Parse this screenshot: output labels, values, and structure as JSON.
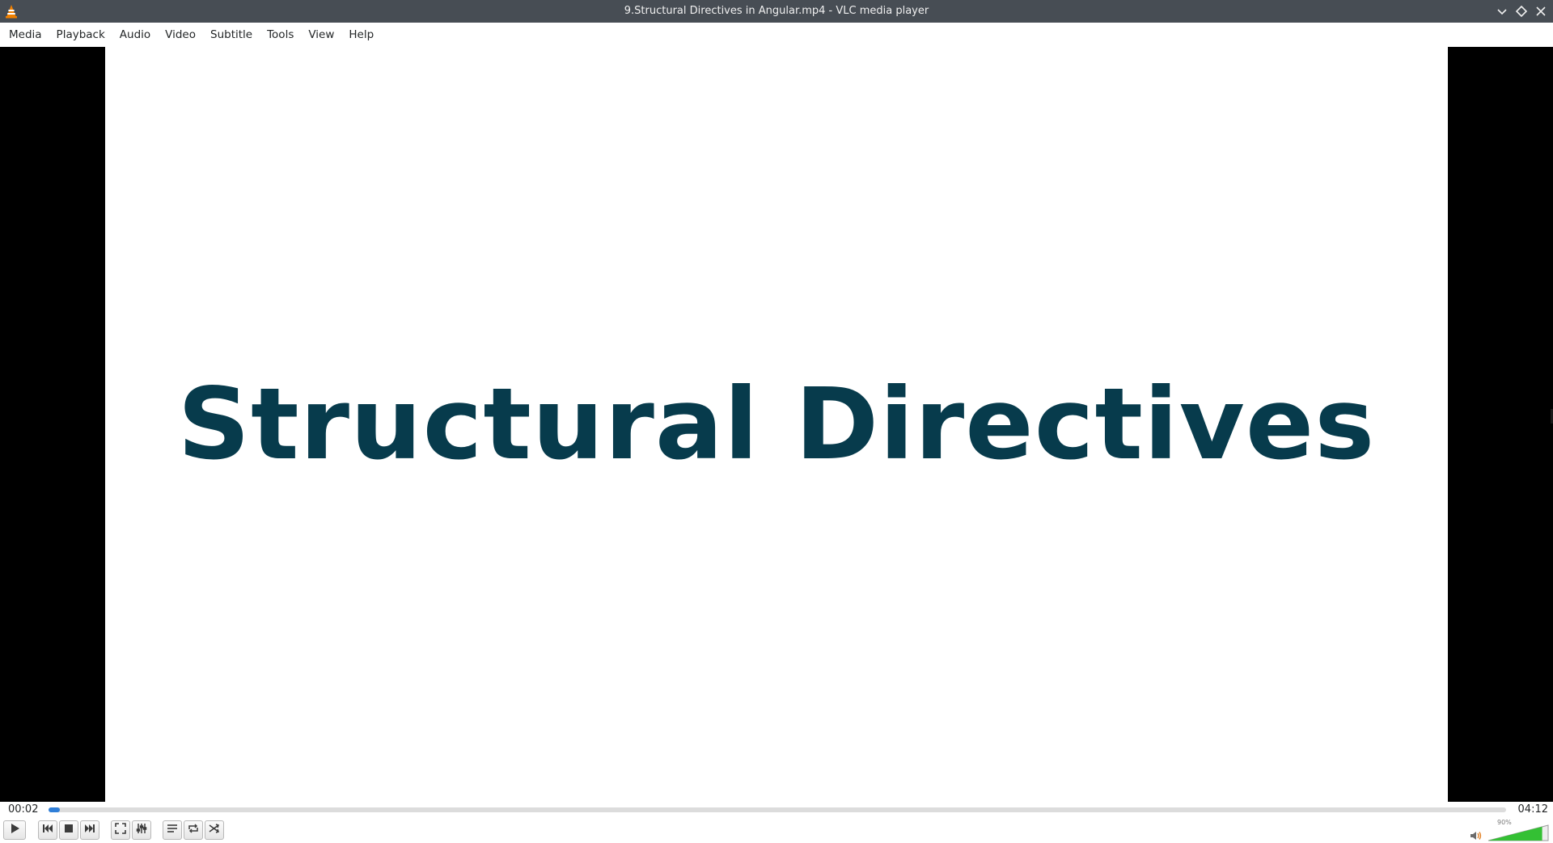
{
  "window": {
    "title": "9.Structural Directives in Angular.mp4 - VLC media player"
  },
  "menu": [
    "Media",
    "Playback",
    "Audio",
    "Video",
    "Subtitle",
    "Tools",
    "View",
    "Help"
  ],
  "video": {
    "frame_text": "Structural Directives",
    "frame_text_color": "#073b4c",
    "background": "#ffffff"
  },
  "playback": {
    "elapsed": "00:02",
    "total": "04:12",
    "progress_fraction": 0.008
  },
  "volume": {
    "label": "90%",
    "level_fraction": 0.9
  },
  "controls": [
    {
      "name": "play-button",
      "icon": "play-icon"
    },
    {
      "name": "previous-button",
      "icon": "skip-back-icon"
    },
    {
      "name": "stop-button",
      "icon": "stop-icon"
    },
    {
      "name": "next-button",
      "icon": "skip-forward-icon"
    },
    {
      "name": "fullscreen-button",
      "icon": "fullscreen-icon"
    },
    {
      "name": "extended-settings-button",
      "icon": "equalizer-icon"
    },
    {
      "name": "playlist-button",
      "icon": "playlist-icon"
    },
    {
      "name": "loop-button",
      "icon": "loop-icon"
    },
    {
      "name": "shuffle-button",
      "icon": "shuffle-icon"
    }
  ],
  "colors": {
    "titlebar": "#474d54",
    "accent": "#2f7ed8",
    "volume_fill": "#34c034"
  }
}
